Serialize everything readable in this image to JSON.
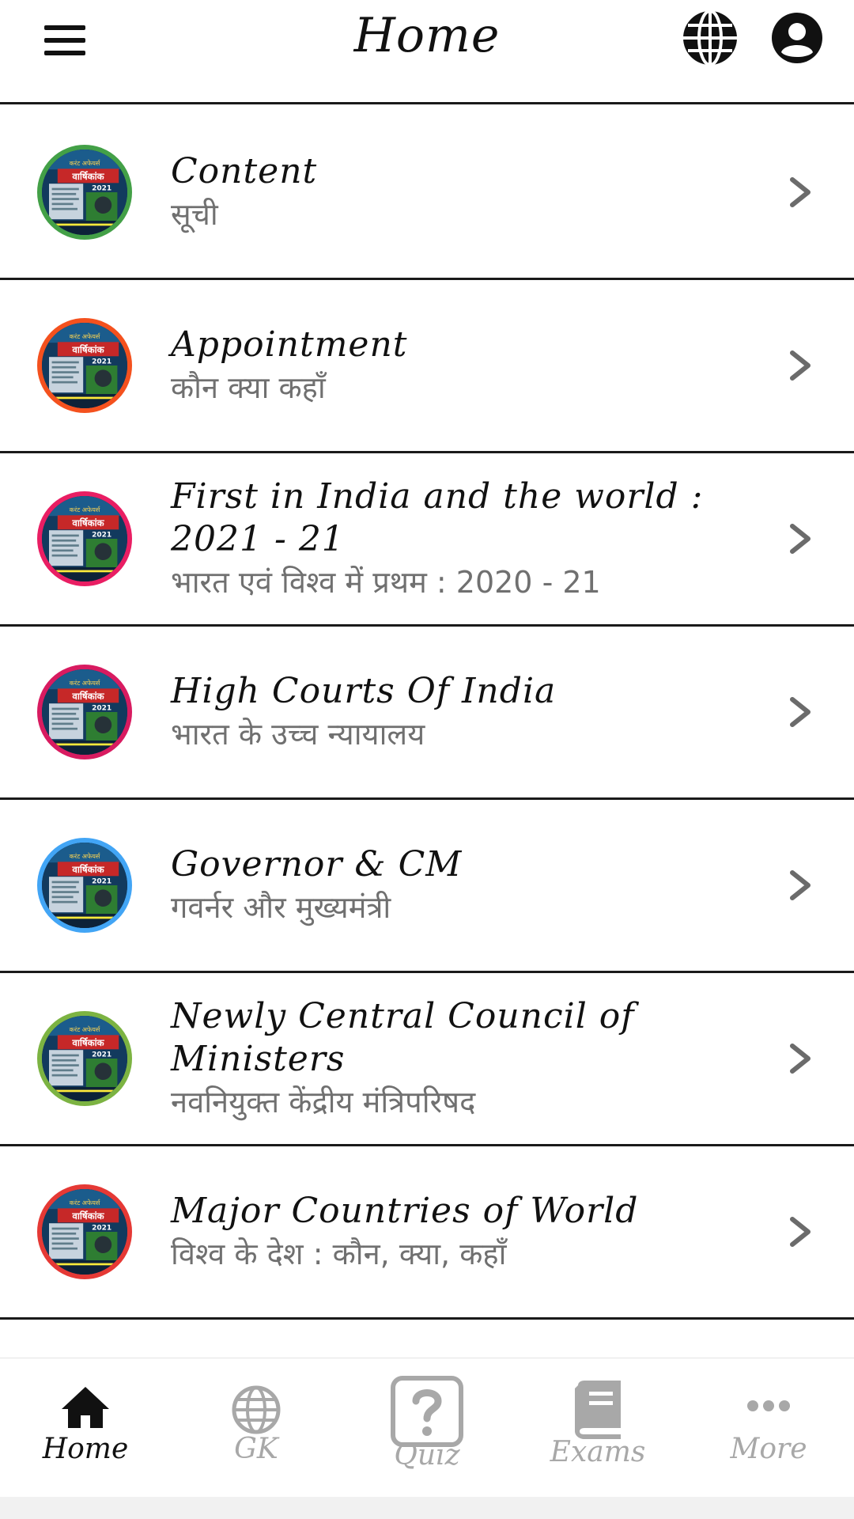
{
  "header": {
    "title": "Home",
    "menu_icon": "hamburger-menu-icon",
    "language_icon": "globe-icon",
    "account_icon": "account-circle-icon"
  },
  "list": [
    {
      "title": "Content",
      "subtitle": "सूची",
      "ring_color": "#43a047"
    },
    {
      "title": "Appointment",
      "subtitle": "कौन क्या कहाँ",
      "ring_color": "#f4511e"
    },
    {
      "title": "First in India and the world : 2021 - 21",
      "subtitle": "भारत एवं विश्व में प्रथम : 2020 - 21",
      "ring_color": "#e91e63"
    },
    {
      "title": "High Courts Of India",
      "subtitle": "भारत के उच्च न्यायालय",
      "ring_color": "#d81b60"
    },
    {
      "title": "Governor & CM",
      "subtitle": "गवर्नर और मुख्यमंत्री",
      "ring_color": "#42a5f5"
    },
    {
      "title": "Newly Central Council of Ministers",
      "subtitle": "नवनियुक्त केंद्रीय मंत्रिपरिषद",
      "ring_color": "#7cb342"
    },
    {
      "title": "Major Countries of World",
      "subtitle": "विश्व के देश : कौन, क्या, कहाँ",
      "ring_color": "#e53935"
    }
  ],
  "cover": {
    "heading": "करंट अफेयर्स",
    "title": "वार्षिकांक",
    "year": "2021"
  },
  "nav": [
    {
      "label": "Home",
      "icon": "home-icon",
      "active": true
    },
    {
      "label": "GK",
      "icon": "globe-icon",
      "active": false
    },
    {
      "label": "Quiz",
      "icon": "help-question-icon",
      "active": false
    },
    {
      "label": "Exams",
      "icon": "book-icon",
      "active": false
    },
    {
      "label": "More",
      "icon": "more-horizontal-icon",
      "active": false
    }
  ],
  "colors": {
    "active": "#111111",
    "inactive": "#a8a8a8",
    "divider": "#1a1a1a"
  }
}
